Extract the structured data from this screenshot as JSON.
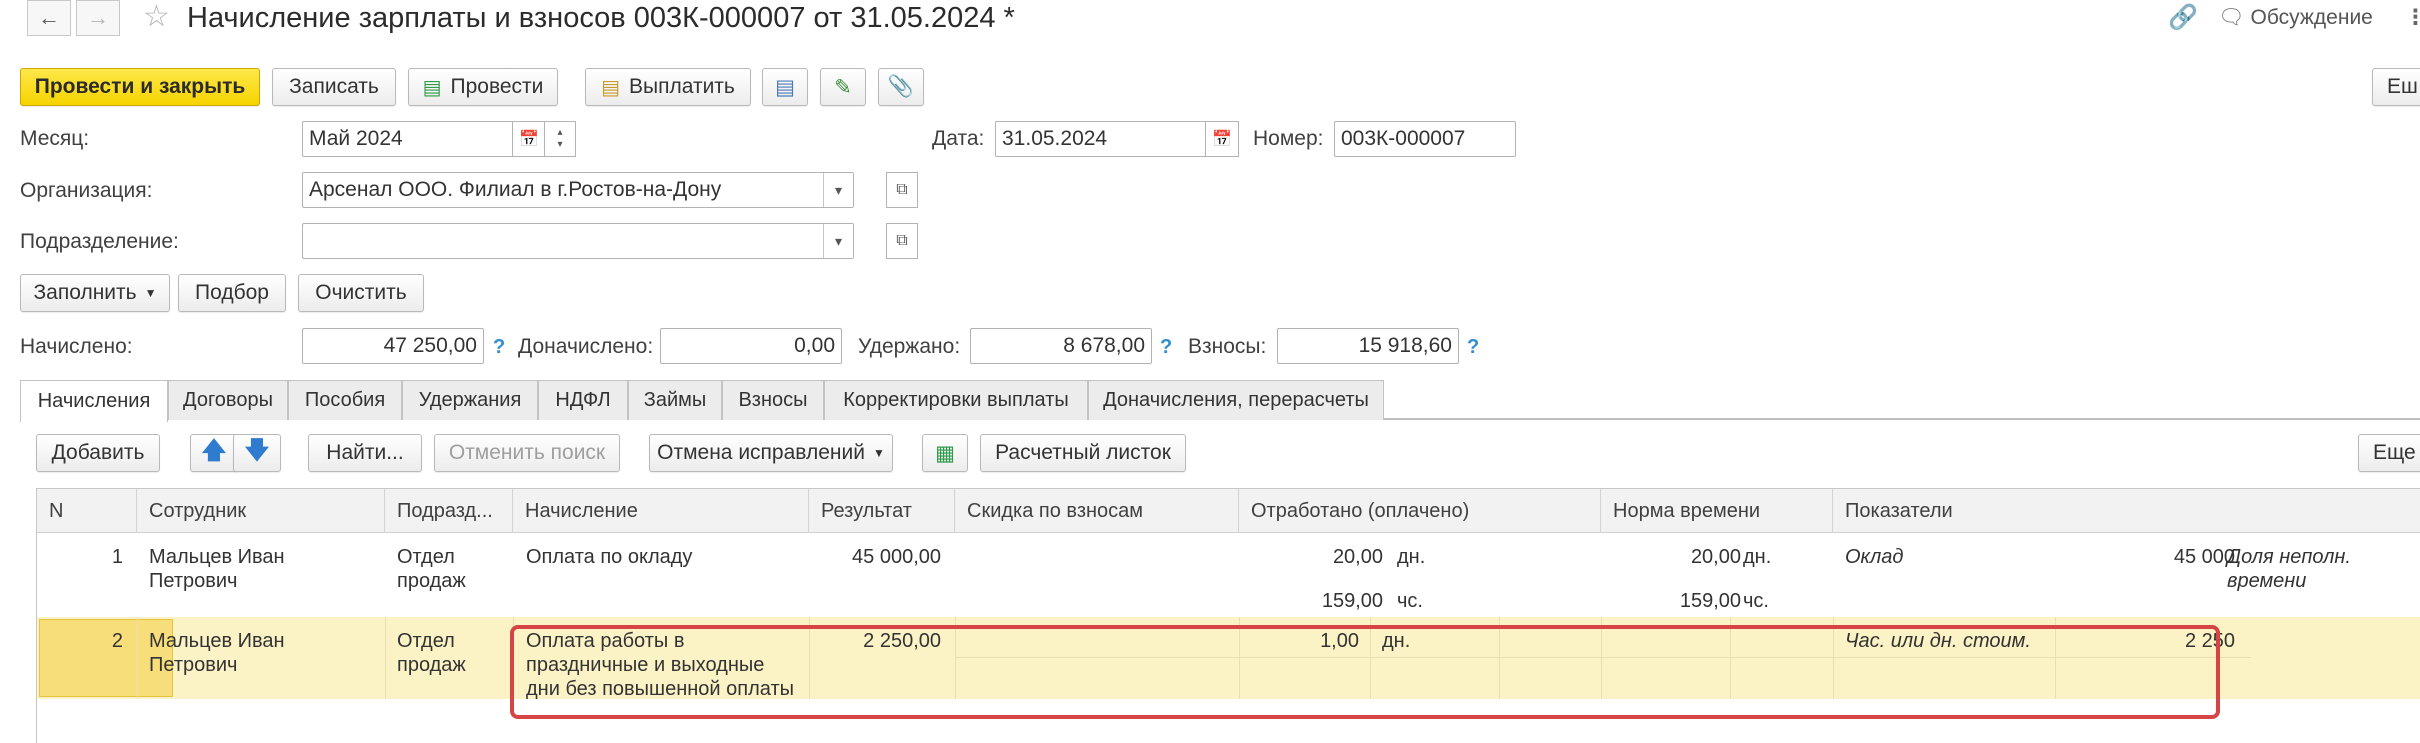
{
  "header": {
    "title": "Начисление зарплаты и взносов 003К-000007 от 31.05.2024 *",
    "discussion": "Обсуждение"
  },
  "toolbar": {
    "post_close": "Провести и закрыть",
    "save": "Записать",
    "post": "Провести",
    "pay": "Выплатить",
    "more_cut": "Еш"
  },
  "form": {
    "month_label": "Месяц:",
    "month_value": "Май 2024",
    "date_label": "Дата:",
    "date_value": "31.05.2024",
    "number_label": "Номер:",
    "number_value": "003К-000007",
    "org_label": "Организация:",
    "org_value": "Арсенал ООО. Филиал в г.Ростов-на-Дону",
    "dept_label": "Подразделение:",
    "dept_value": ""
  },
  "actions": {
    "fill": "Заполнить",
    "pick": "Подбор",
    "clear": "Очистить"
  },
  "totals": {
    "accrued_label": "Начислено:",
    "accrued_value": "47 250,00",
    "extra_label": "Доначислено:",
    "extra_value": "0,00",
    "withheld_label": "Удержано:",
    "withheld_value": "8 678,00",
    "contrib_label": "Взносы:",
    "contrib_value": "15 918,60",
    "help": "?"
  },
  "tabs": [
    "Начисления",
    "Договоры",
    "Пособия",
    "Удержания",
    "НДФЛ",
    "Займы",
    "Взносы",
    "Корректировки выплаты",
    "Доначисления, перерасчеты"
  ],
  "table_toolbar": {
    "add": "Добавить",
    "find": "Найти...",
    "cancel_search": "Отменить поиск",
    "cancel_fix": "Отмена исправлений",
    "payslip": "Расчетный листок",
    "more": "Еще"
  },
  "columns": [
    "N",
    "Сотрудник",
    "Подразд...",
    "Начисление",
    "Результат",
    "Скидка по взносам",
    "Отработано (оплачено)",
    "Норма времени",
    "Показатели"
  ],
  "rows": [
    {
      "n": "1",
      "employee_1": "Мальцев Иван",
      "employee_2": "Петрович",
      "dept_1": "Отдел",
      "dept_2": "продаж",
      "accrual_1": "Оплата по окладу",
      "result": "45 000,00",
      "worked_days": "20,00",
      "days_unit": "дн.",
      "worked_hours": "159,00",
      "hours_unit": "чс.",
      "norm_days": "20,00",
      "norm_days_unit": "дн.",
      "norm_hours": "159,00",
      "norm_hours_unit": "чс.",
      "indicator": "Оклад",
      "indicator_value": "45 000",
      "indicator2_1": "Доля неполн.",
      "indicator2_2": "времени"
    },
    {
      "n": "2",
      "employee_1": "Мальцев Иван",
      "employee_2": "Петрович",
      "dept_1": "Отдел",
      "dept_2": "продаж",
      "accrual_1": "Оплата работы в",
      "accrual_2": "праздничные и выходные",
      "accrual_3": "дни без повышенной оплаты",
      "result": "2 250,00",
      "worked_days": "1,00",
      "days_unit": "дн.",
      "indicator": "Час. или дн. стоим.",
      "indicator_value": "2 250"
    }
  ],
  "colors": {
    "primary_button": "#f6d300",
    "selected_row": "#fbf2c5",
    "highlight_frame": "#d64545",
    "help_icon": "#2f8dd0"
  }
}
